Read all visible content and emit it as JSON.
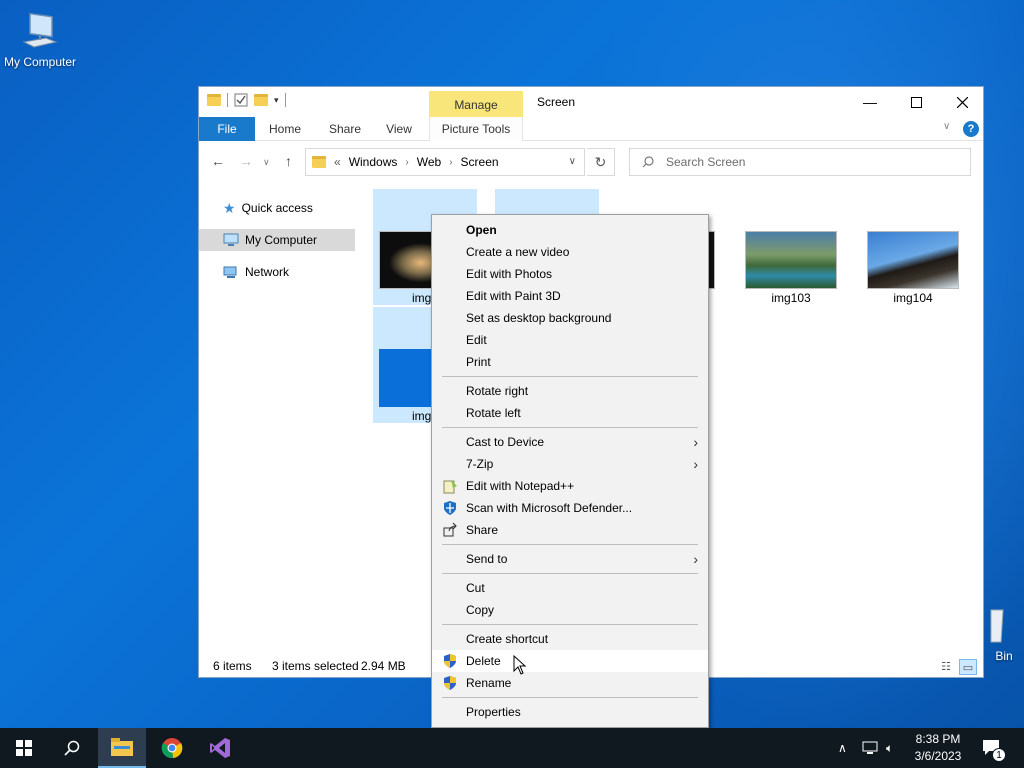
{
  "desktop": {
    "my_computer_label": "My Computer",
    "recycle_bin_label": "Bin"
  },
  "window": {
    "title": "Screen",
    "manage_tab": "Manage",
    "ribbon_tabs": [
      "File",
      "Home",
      "Share",
      "View",
      "Picture Tools"
    ],
    "breadcrumb": [
      "Windows",
      "Web",
      "Screen"
    ],
    "breadcrumb_prefix": "«",
    "search_placeholder": "Search Screen"
  },
  "nav_pane": {
    "items": [
      {
        "label": "Quick access",
        "icon": "star-icon"
      },
      {
        "label": "My Computer",
        "icon": "computer-icon"
      },
      {
        "label": "Network",
        "icon": "network-icon"
      }
    ]
  },
  "files": [
    {
      "label": "img1",
      "selected": true
    },
    {
      "label": "",
      "selected": true
    },
    {
      "label": "",
      "selected": false
    },
    {
      "label": "img103",
      "selected": false
    },
    {
      "label": "img104",
      "selected": false
    },
    {
      "label": "img1",
      "selected": true
    }
  ],
  "status": {
    "items": "6 items",
    "selected": "3 items selected",
    "size": "2.94 MB"
  },
  "context_menu": {
    "group1": [
      "Open",
      "Create a new video",
      "Edit with Photos",
      "Edit with Paint 3D",
      "Set as desktop background",
      "Edit",
      "Print"
    ],
    "group2": [
      "Rotate right",
      "Rotate left"
    ],
    "group3": [
      "Cast to Device",
      "7-Zip",
      "Edit with Notepad++",
      "Scan with Microsoft Defender...",
      "Share"
    ],
    "group4": [
      "Send to"
    ],
    "group5": [
      "Cut",
      "Copy"
    ],
    "group6": [
      "Create shortcut",
      "Delete",
      "Rename"
    ],
    "group7": [
      "Properties"
    ]
  },
  "taskbar": {
    "time": "8:38 PM",
    "date": "3/6/2023",
    "notification_count": "1"
  },
  "colors": {
    "accent": "#1979ca",
    "selection": "#cce8ff",
    "manage": "#f8e67a"
  }
}
